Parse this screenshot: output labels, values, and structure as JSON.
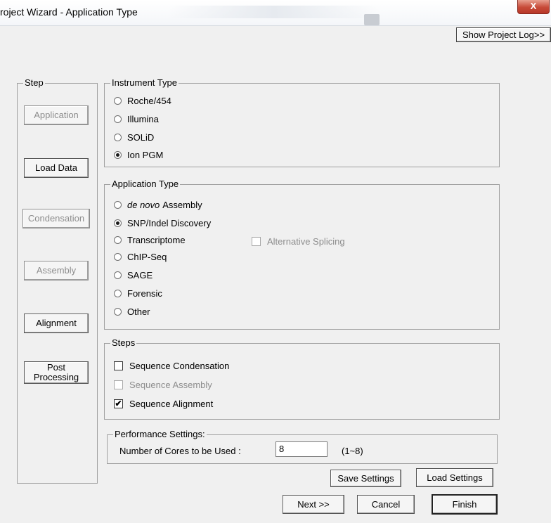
{
  "window": {
    "title": "roject Wizard - Application Type",
    "close_label": "X"
  },
  "toolbar": {
    "show_log_label": "Show Project Log>>"
  },
  "step_panel": {
    "legend": "Step",
    "items": [
      {
        "label": "Application",
        "enabled": false
      },
      {
        "label": "Load Data",
        "enabled": true
      },
      {
        "label": "Condensation",
        "enabled": false
      },
      {
        "label": "Assembly",
        "enabled": false
      },
      {
        "label": "Alignment",
        "enabled": true
      },
      {
        "label": "Post Processing",
        "enabled": true
      }
    ]
  },
  "instrument_type": {
    "legend": "Instrument Type",
    "options": [
      {
        "label": "Roche/454",
        "selected": false
      },
      {
        "label": "Illumina",
        "selected": false
      },
      {
        "label": "SOLiD",
        "selected": false
      },
      {
        "label": "Ion PGM",
        "selected": true
      }
    ]
  },
  "application_type": {
    "legend": "Application Type",
    "options": [
      {
        "label_italic": "de novo",
        "label": "Assembly",
        "selected": false
      },
      {
        "label": "SNP/Indel Discovery",
        "selected": true
      },
      {
        "label": "Transcriptome",
        "selected": false
      },
      {
        "label": "ChIP-Seq",
        "selected": false
      },
      {
        "label": "SAGE",
        "selected": false
      },
      {
        "label": "Forensic",
        "selected": false
      },
      {
        "label": "Other",
        "selected": false
      }
    ],
    "alt_splicing": {
      "label": "Alternative Splicing",
      "checked": false,
      "enabled": false
    }
  },
  "steps": {
    "legend": "Steps",
    "items": [
      {
        "label": "Sequence Condensation",
        "checked": false,
        "enabled": true
      },
      {
        "label": "Sequence Assembly",
        "checked": false,
        "enabled": false
      },
      {
        "label": "Sequence Alignment",
        "checked": true,
        "enabled": true
      }
    ]
  },
  "performance": {
    "legend": "Performance Settings:",
    "cores_label": "Number of Cores to be Used :",
    "cores_value": "8",
    "cores_range": "(1~8)"
  },
  "buttons": {
    "save_settings": "Save Settings",
    "load_settings": "Load Settings",
    "next": "Next >>",
    "cancel": "Cancel",
    "finish": "Finish"
  },
  "icons": {
    "check": "✔"
  }
}
